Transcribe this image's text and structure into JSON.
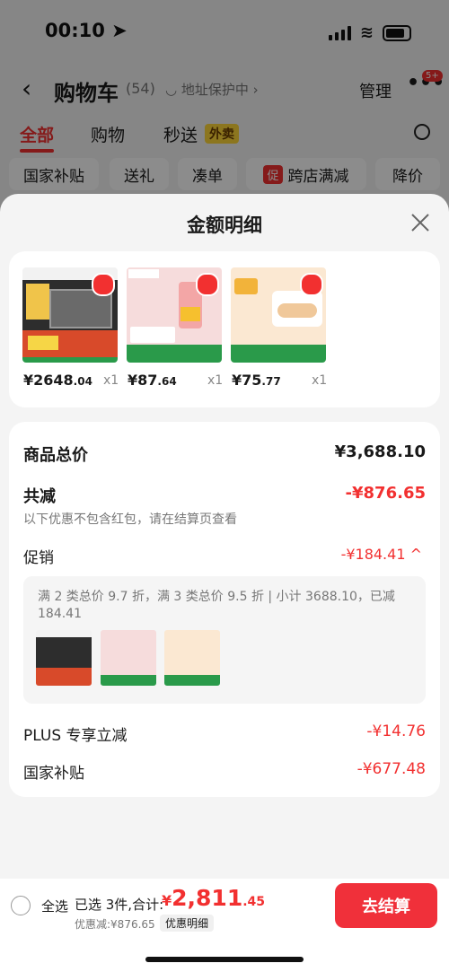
{
  "status": {
    "time": "00:10"
  },
  "header": {
    "title": "购物车",
    "count": "(54)",
    "address": "◡ 地址保护中 ›",
    "manage": "管理",
    "more": "•••",
    "badge": "5+"
  },
  "tabs": [
    "全部",
    "购物",
    "秒送"
  ],
  "tab_tag": "外卖",
  "chips": [
    "国家补贴",
    "送礼",
    "凑单",
    "跨店满减",
    "降价"
  ],
  "chip_icon": "促",
  "sheet": {
    "title": "金额明细"
  },
  "products": [
    {
      "price_main": "¥2648",
      "price_dec": ".04",
      "qty": "x1"
    },
    {
      "price_main": "¥87",
      "price_dec": ".64",
      "qty": "x1"
    },
    {
      "price_main": "¥75",
      "price_dec": ".77",
      "qty": "x1"
    }
  ],
  "summary": {
    "total_label": "商品总价",
    "total_value": "¥3,688.10",
    "discount_label": "共减",
    "discount_value": "-¥876.65",
    "discount_note": "以下优惠不包含红包，请在结算页查看",
    "promo_label": "促销",
    "promo_value": "-¥184.41 ^",
    "promo_desc": "满 2 类总价 9.7 折，满 3 类总价 9.5 折 | 小计 3688.10，已减 184.41",
    "plus_label": "PLUS 专享立减",
    "plus_value": "-¥14.76",
    "subsidy_label": "国家补贴",
    "subsidy_value": "-¥677.48"
  },
  "bottom": {
    "select_all": "全选",
    "selected": "已选 3件,合计:",
    "currency": "¥",
    "total_int": "2,811",
    "total_dec": ".45",
    "saved": "优惠减:¥876.65",
    "detail": "优惠明细",
    "checkout": "去结算"
  },
  "colors": {
    "accent": "#f23030"
  }
}
